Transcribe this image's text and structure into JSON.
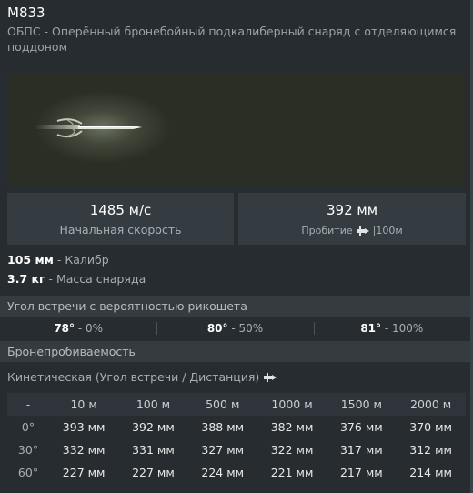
{
  "shell": {
    "name": "M833",
    "description": "ОБПС - Оперённый бронебойный подкалиберный снаряд с отделяющимся поддоном"
  },
  "stats": {
    "muzzle_velocity": {
      "value": "1485 м/с",
      "label": "Начальная скорость"
    },
    "penetration": {
      "value": "392 мм",
      "label": "Пробитие",
      "range_note": "|100м"
    }
  },
  "specs": [
    {
      "value": "105 мм",
      "label": " - Калибр"
    },
    {
      "value": "3.7 кг",
      "label": " - Масса снаряда"
    }
  ],
  "ricochet": {
    "title": "Угол встречи с вероятностью рикошета",
    "entries": [
      {
        "angle": "78°",
        "chance": " - 0%"
      },
      {
        "angle": "80°",
        "chance": " - 50%"
      },
      {
        "angle": "81°",
        "chance": " - 100%"
      }
    ]
  },
  "armor": {
    "title": "Бронепробиваемость",
    "subtitle": "Кинетическая (Угол встречи / Дистанция)",
    "corner": "-",
    "distances": [
      "10 м",
      "100 м",
      "500 м",
      "1000 м",
      "1500 м",
      "2000 м"
    ],
    "rows": [
      {
        "angle": "0°",
        "values": [
          "393 мм",
          "392 мм",
          "388 мм",
          "382 мм",
          "376 мм",
          "370 мм"
        ]
      },
      {
        "angle": "30°",
        "values": [
          "332 мм",
          "331 мм",
          "327 мм",
          "322 мм",
          "317 мм",
          "312 мм"
        ]
      },
      {
        "angle": "60°",
        "values": [
          "227 мм",
          "227 мм",
          "224 мм",
          "221 мм",
          "217 мм",
          "214 мм"
        ]
      }
    ]
  },
  "icons": {
    "penetration": "shell-penetration-icon",
    "kinetic": "shell-penetration-icon"
  }
}
